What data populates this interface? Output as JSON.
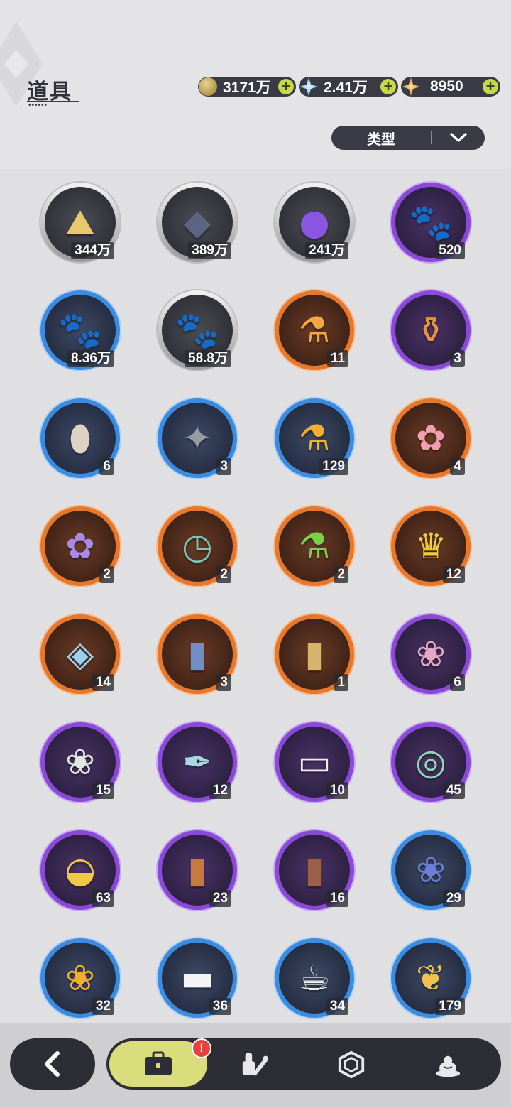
{
  "header": {
    "title": "道具"
  },
  "currencies": [
    {
      "value": "3171万",
      "icon": "gold-coin-icon",
      "color": "#b89a4a"
    },
    {
      "value": "2.41万",
      "icon": "crystal-star-icon",
      "color": "#8fd0e8"
    },
    {
      "value": "8950",
      "icon": "orange-star-icon",
      "color": "#e0913c"
    }
  ],
  "plus_label": "+",
  "filter": {
    "label": "类型"
  },
  "items": [
    {
      "count": "344万",
      "rarity": "gray",
      "icon": "gold-sand-icon"
    },
    {
      "count": "389万",
      "rarity": "gray",
      "icon": "dark-crystal-icon"
    },
    {
      "count": "241万",
      "rarity": "gray",
      "icon": "purple-orb-icon"
    },
    {
      "count": "520",
      "rarity": "purple",
      "icon": "pink-food-bag-icon"
    },
    {
      "count": "8.36万",
      "rarity": "blue",
      "icon": "blue-food-bag-icon"
    },
    {
      "count": "58.8万",
      "rarity": "gray",
      "icon": "brown-food-bag-icon"
    },
    {
      "count": "11",
      "rarity": "orange",
      "icon": "potion-bottle-icon"
    },
    {
      "count": "3",
      "rarity": "purple",
      "icon": "orange-potion-icon"
    },
    {
      "count": "6",
      "rarity": "blue",
      "icon": "egg-icon"
    },
    {
      "count": "3",
      "rarity": "blue",
      "icon": "feather-bundle-icon"
    },
    {
      "count": "129",
      "rarity": "blue",
      "icon": "vial-icon"
    },
    {
      "count": "4",
      "rarity": "orange",
      "icon": "pink-bouquet-icon"
    },
    {
      "count": "2",
      "rarity": "orange",
      "icon": "purple-bouquet-icon"
    },
    {
      "count": "2",
      "rarity": "orange",
      "icon": "pocket-watch-icon"
    },
    {
      "count": "2",
      "rarity": "orange",
      "icon": "green-potion-icon"
    },
    {
      "count": "12",
      "rarity": "orange",
      "icon": "golden-crown-icon"
    },
    {
      "count": "14",
      "rarity": "orange",
      "icon": "diamond-gift-icon"
    },
    {
      "count": "3",
      "rarity": "orange",
      "icon": "blue-book-icon"
    },
    {
      "count": "1",
      "rarity": "orange",
      "icon": "gold-book-icon"
    },
    {
      "count": "6",
      "rarity": "purple",
      "icon": "blossom-bouquet-icon"
    },
    {
      "count": "15",
      "rarity": "purple",
      "icon": "white-bouquet-icon"
    },
    {
      "count": "12",
      "rarity": "purple",
      "icon": "quill-ink-icon"
    },
    {
      "count": "10",
      "rarity": "purple",
      "icon": "pillow-icon"
    },
    {
      "count": "45",
      "rarity": "purple",
      "icon": "jade-pendant-icon"
    },
    {
      "count": "63",
      "rarity": "purple",
      "icon": "gold-ingot-icon"
    },
    {
      "count": "23",
      "rarity": "purple",
      "icon": "brown-book-icon"
    },
    {
      "count": "16",
      "rarity": "purple",
      "icon": "leather-book-icon"
    },
    {
      "count": "29",
      "rarity": "blue",
      "icon": "blue-bouquet-icon"
    },
    {
      "count": "32",
      "rarity": "blue",
      "icon": "yellow-bouquet-icon"
    },
    {
      "count": "36",
      "rarity": "blue",
      "icon": "towel-icon"
    },
    {
      "count": "34",
      "rarity": "blue",
      "icon": "teacup-icon"
    },
    {
      "count": "179",
      "rarity": "blue",
      "icon": "golden-leaf-icon"
    }
  ],
  "nav": {
    "badge": "!",
    "tabs": [
      {
        "icon": "bag-icon",
        "active": true
      },
      {
        "icon": "tools-icon",
        "active": false
      },
      {
        "icon": "gem-frame-icon",
        "active": false
      },
      {
        "icon": "dessert-icon",
        "active": false
      }
    ]
  },
  "colors": {
    "accent": "#d9dd7b",
    "plus": "#c6d748",
    "dark": "#2c2d35"
  }
}
